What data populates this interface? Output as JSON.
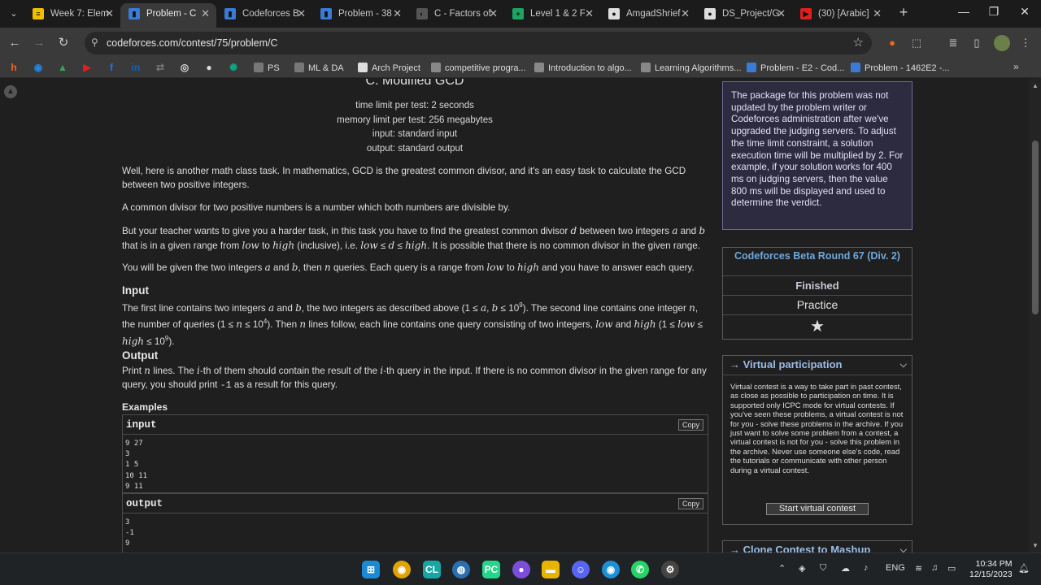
{
  "browser": {
    "tabs": [
      {
        "title": "Week 7: Elem",
        "active": false,
        "favicon_color": "#f0c000",
        "favicon": "≡"
      },
      {
        "title": "Problem - C",
        "active": true,
        "favicon_color": "#3a7bd5",
        "favicon": "▮"
      },
      {
        "title": "Codeforces B",
        "active": false,
        "favicon_color": "#3a7bd5",
        "favicon": "▮"
      },
      {
        "title": "Problem - 38",
        "active": false,
        "favicon_color": "#3a7bd5",
        "favicon": "▮"
      },
      {
        "title": "C - Factors of",
        "active": false,
        "favicon_color": "#555555",
        "favicon": "◐"
      },
      {
        "title": "Level 1 & 2 F",
        "active": false,
        "favicon_color": "#1ea362",
        "favicon": "+"
      },
      {
        "title": "AmgadShrief",
        "active": false,
        "favicon_color": "#dddddd",
        "favicon": "●"
      },
      {
        "title": "DS_Project/G",
        "active": false,
        "favicon_color": "#dddddd",
        "favicon": "●"
      },
      {
        "title": "(30) [Arabic]",
        "active": false,
        "favicon_color": "#e02020",
        "favicon": "▶"
      }
    ],
    "url": "codeforces.com/contest/75/problem/C",
    "bookmarks": [
      {
        "label": "PS",
        "color": "#777777"
      },
      {
        "label": "ML & DA",
        "color": "#777777"
      },
      {
        "label": "Arch Project",
        "color": "#dddddd"
      },
      {
        "label": "competitive progra...",
        "color": "#888888"
      },
      {
        "label": "Introduction to algo...",
        "color": "#888888"
      },
      {
        "label": "Learning Algorithms...",
        "color": "#888888"
      },
      {
        "label": "Problem - E2 - Cod...",
        "color": "#3a7bd5"
      },
      {
        "label": "Problem - 1462E2 -...",
        "color": "#3a7bd5"
      }
    ],
    "bookmark_icons": [
      {
        "name": "hacker-icon",
        "glyph": "h",
        "color": "#f26522"
      },
      {
        "name": "edge-icon",
        "glyph": "◉",
        "color": "#1e88e5"
      },
      {
        "name": "drive-icon",
        "glyph": "▲",
        "color": "#34a853"
      },
      {
        "name": "youtube-icon",
        "glyph": "▶",
        "color": "#e02020"
      },
      {
        "name": "facebook-icon",
        "glyph": "f",
        "color": "#1877f2"
      },
      {
        "name": "linkedin-icon",
        "glyph": "in",
        "color": "#0a66c2"
      },
      {
        "name": "translate-icon",
        "glyph": "⇄",
        "color": "#777777"
      },
      {
        "name": "instapaper-icon",
        "glyph": "◎",
        "color": "#dddddd"
      },
      {
        "name": "github-icon",
        "glyph": "●",
        "color": "#dddddd"
      },
      {
        "name": "chatgpt-icon",
        "glyph": "✺",
        "color": "#10a37f"
      }
    ]
  },
  "problem": {
    "title": "C. Modified GCD",
    "time_limit": "time limit per test: 2 seconds",
    "memory_limit": "memory limit per test: 256 megabytes",
    "input_file": "input: standard input",
    "output_file": "output: standard output",
    "input_title": "Input",
    "output_title": "Output",
    "examples_title": "Examples",
    "example_input_label": "input",
    "example_output_label": "output",
    "copy_label": "Copy",
    "example_input": [
      "9 27",
      "3",
      "1 5",
      "10 11",
      "9 11"
    ],
    "example_output": [
      "3",
      "-1",
      "9"
    ]
  },
  "sidebar": {
    "notice": "The package for this problem was not updated by the problem writer or Codeforces administration after we've upgraded the judging servers. To adjust the time limit constraint, a solution execution time will be multiplied by 2. For example, if your solution works for 400 ms on judging servers, then the value 800 ms will be displayed and used to determine the verdict.",
    "contest_name": "Codeforces Beta Round 67 (Div. 2)",
    "contest_status": "Finished",
    "contest_mode": "Practice",
    "virtual_title": "→ Virtual participation",
    "virtual_text": "Virtual contest is a way to take part in past contest, as close as possible to participation on time. It is supported only ICPC mode for virtual contests. If you've seen these problems, a virtual contest is not for you - solve these problems in the archive. If you just want to solve some problem from a contest, a virtual contest is not for you - solve this problem in the archive. Never use someone else's code, read the tutorials or communicate with other person during a virtual contest.",
    "virtual_button": "Start virtual contest",
    "clone_title": "→ Clone Contest to Mashup"
  },
  "taskbar": {
    "lang": "ENG",
    "time": "10:34 PM",
    "date": "12/15/2023"
  }
}
